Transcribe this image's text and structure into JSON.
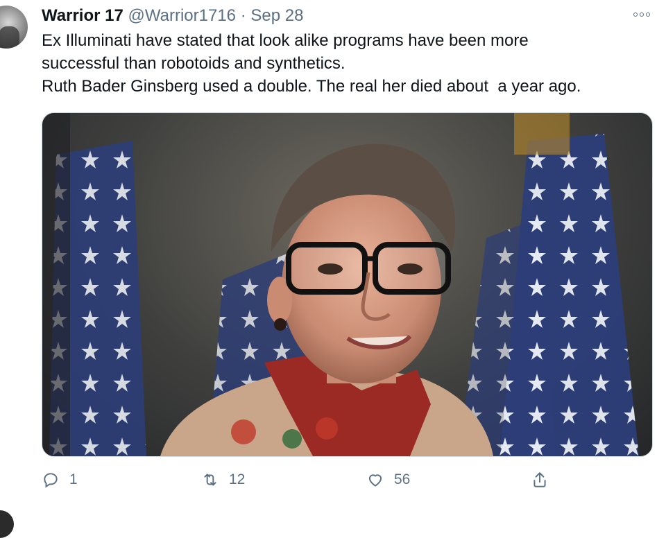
{
  "tweet": {
    "display_name": "Warrior 17",
    "handle": "@Warrior1716",
    "separator": "·",
    "date": "Sep 28",
    "lines": [
      "Ex Illuminati have stated that look alike programs have been more",
      "successful than robotoids and synthetics.",
      "Ruth Bader Ginsberg used a double. The real her died about  a year ago."
    ]
  },
  "actions": {
    "reply_count": "1",
    "retweet_count": "12",
    "like_count": "56"
  },
  "icons": {
    "more": "more-options-icon",
    "reply": "reply-icon",
    "retweet": "retweet-icon",
    "like": "heart-icon",
    "share": "share-icon"
  },
  "colors": {
    "text": "#0f1419",
    "secondary": "#5b7083",
    "border": "#cfd9de"
  }
}
